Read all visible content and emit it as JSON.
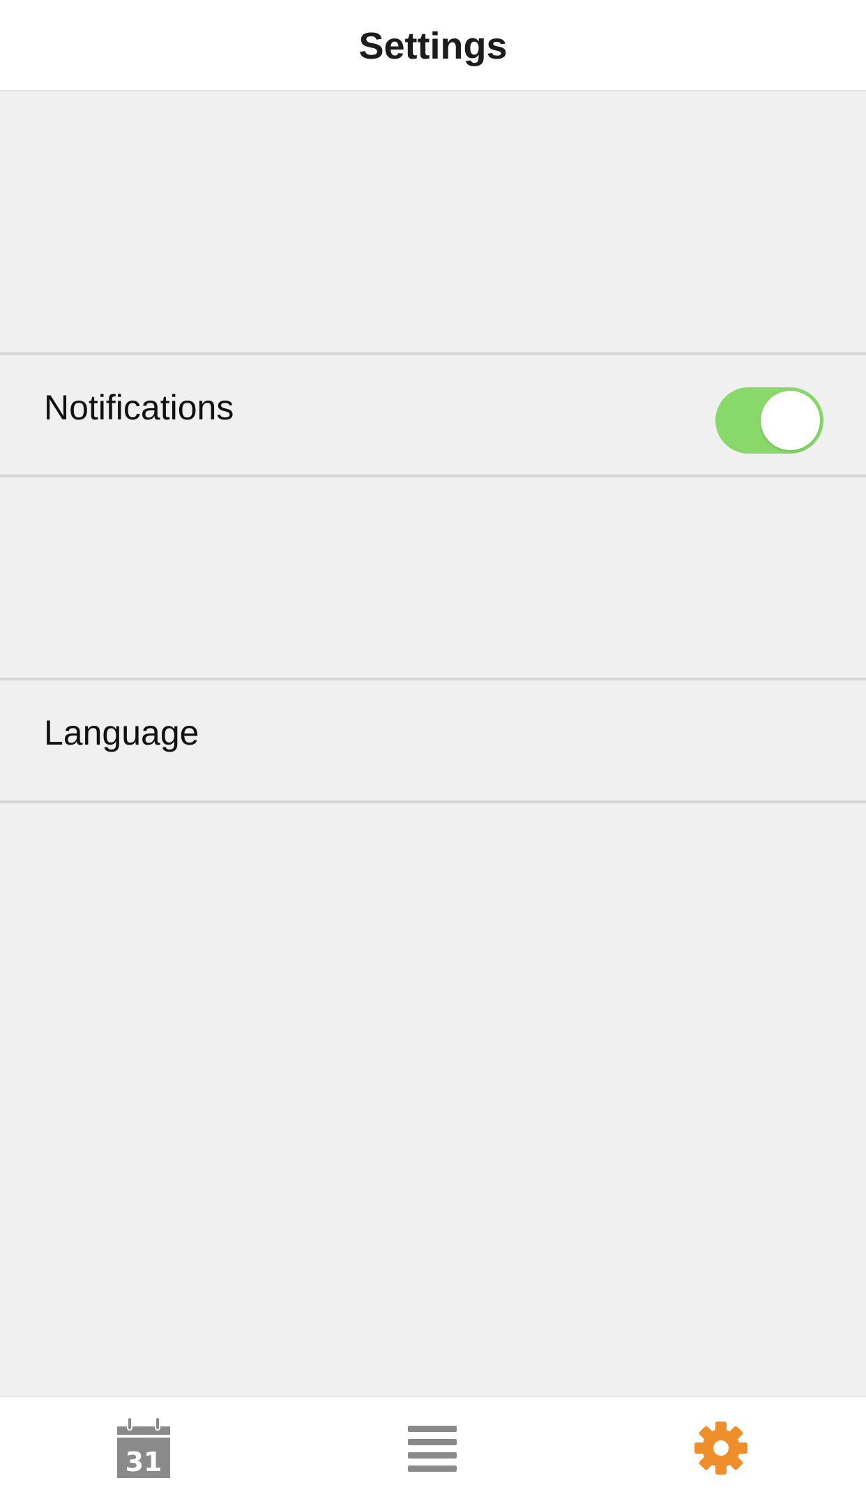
{
  "header": {
    "title": "Settings"
  },
  "settings": {
    "notifications": {
      "label": "Notifications",
      "enabled": true,
      "toggle_color": "#88d86a"
    },
    "language": {
      "label": "Language"
    }
  },
  "tabbar": {
    "tabs": [
      {
        "name": "calendar",
        "icon": "calendar-icon",
        "text": "31",
        "active": false
      },
      {
        "name": "list",
        "icon": "list-icon",
        "active": false
      },
      {
        "name": "settings",
        "icon": "gear-icon",
        "active": true
      }
    ],
    "active_color": "#f08e2c",
    "inactive_color": "#8a8a8a"
  }
}
